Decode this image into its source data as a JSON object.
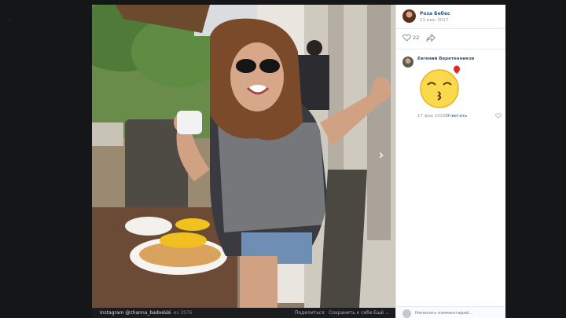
{
  "page": {
    "hint": "···"
  },
  "viewer": {
    "next_icon": "chevron-right-icon",
    "footer": {
      "owner_link": "Instagram @zhanna_badoeva",
      "counter": "335 из 3976",
      "share": "Поделиться",
      "save": "Сохранить к себе",
      "more": "Ещё ⌄"
    }
  },
  "side": {
    "owner": {
      "name": "Роза Бебес",
      "date": "21 июн 2017"
    },
    "likes": {
      "count": "22",
      "icon": "heart-icon",
      "share_icon": "share-arrow-icon"
    },
    "comments": [
      {
        "author": "Евгений Веретенников",
        "sticker": "kiss-emoji-sticker",
        "date": "17 фев 2025",
        "reply": "Ответить"
      }
    ],
    "comment_input": {
      "placeholder": "Написать комментарий..."
    }
  }
}
